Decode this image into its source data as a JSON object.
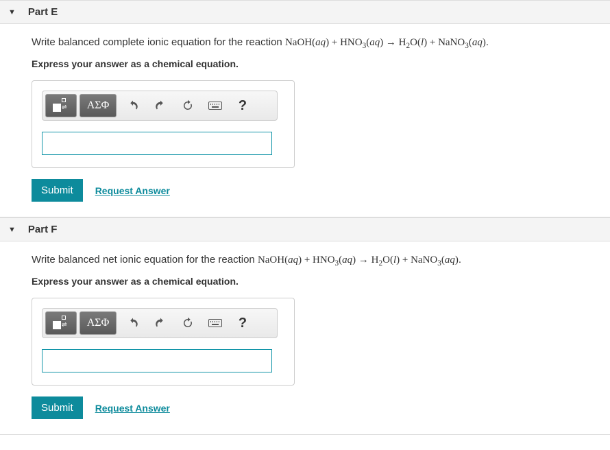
{
  "parts": {
    "e": {
      "title": "Part E",
      "prompt_prefix": "Write balanced complete ionic equation for the reaction ",
      "equation": "NaOH(aq) + HNO₃(aq) → H₂O(l) + NaNO₃(aq)",
      "prompt_suffix": ".",
      "instruction": "Express your answer as a chemical equation.",
      "greek_label": "ΑΣΦ",
      "help_label": "?",
      "input_value": "",
      "submit_label": "Submit",
      "request_label": "Request Answer"
    },
    "f": {
      "title": "Part F",
      "prompt_prefix": "Write balanced net ionic equation for the reaction ",
      "equation": "NaOH(aq) + HNO₃(aq) → H₂O(l) + NaNO₃(aq)",
      "prompt_suffix": ".",
      "instruction": "Express your answer as a chemical equation.",
      "greek_label": "ΑΣΦ",
      "help_label": "?",
      "input_value": "",
      "submit_label": "Submit",
      "request_label": "Request Answer"
    }
  }
}
